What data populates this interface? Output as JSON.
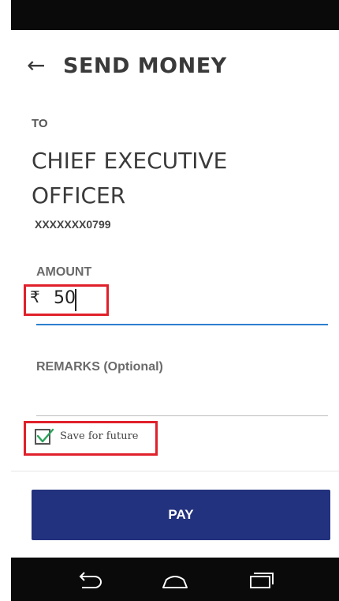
{
  "header": {
    "title": "SEND MONEY",
    "back_icon": "back-arrow-icon"
  },
  "recipient": {
    "to_label": "TO",
    "name": "CHIEF EXECUTIVE OFFICER",
    "account": "XXXXXXX0799"
  },
  "amount": {
    "label": "AMOUNT",
    "currency_symbol": "₹",
    "value": "50"
  },
  "remarks": {
    "label": "REMARKS (Optional)",
    "value": ""
  },
  "save_option": {
    "label": "Save for future",
    "checked": true
  },
  "pay_button": {
    "label": "PAY",
    "color": "#23327e"
  },
  "nav": {
    "back_icon": "nav-back-icon",
    "home_icon": "nav-home-icon",
    "recents_icon": "nav-recents-icon"
  },
  "highlight_color": "#e0202a"
}
